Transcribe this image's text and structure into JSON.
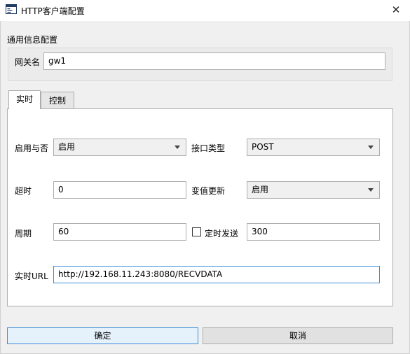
{
  "window": {
    "title": "HTTP客户端配置",
    "close_glyph": "✕"
  },
  "general": {
    "group_title": "通用信息配置",
    "gateway_label": "网关名",
    "gateway_value": "gw1"
  },
  "tabs": [
    {
      "label": "实时",
      "active": true
    },
    {
      "label": "控制",
      "active": false
    }
  ],
  "realtime": {
    "enable_label": "启用与否",
    "enable_value": "启用",
    "interface_label": "接口类型",
    "interface_value": "POST",
    "timeout_label": "超时",
    "timeout_value": "0",
    "change_update_label": "变值更新",
    "change_update_value": "启用",
    "period_label": "周期",
    "period_value": "60",
    "timed_send_label": "定时发送",
    "timed_send_checked": false,
    "timed_send_value": "300",
    "url_label": "实时URL",
    "url_value": "http://192.168.11.243:8080/RECVDATA"
  },
  "buttons": {
    "ok": "确定",
    "cancel": "取消"
  },
  "colors": {
    "focus_border": "#3c8ed8",
    "window_bg": "#f0f0f0"
  }
}
